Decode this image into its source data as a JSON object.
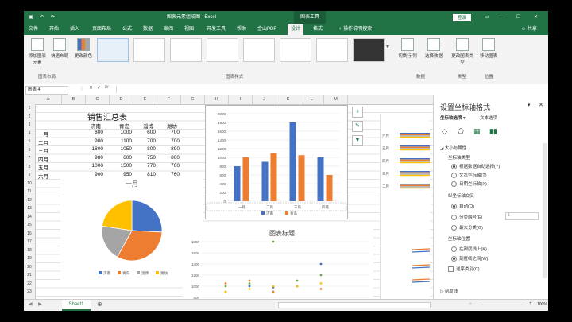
{
  "window": {
    "title": "图表元素组成图 - Excel",
    "context_tab": "图表工具",
    "login": "登录",
    "share": "共享"
  },
  "tabs": [
    "文件",
    "开始",
    "插入",
    "页面布局",
    "公式",
    "数据",
    "审阅",
    "视图",
    "开发工具",
    "帮助",
    "金山PDF",
    "设计",
    "格式",
    "操作说明搜索"
  ],
  "ribbon": {
    "buttons": [
      "添加图表元素",
      "快速布局",
      "更改颜色",
      "切换行/列",
      "选择数据",
      "更改图表类型",
      "移动图表"
    ],
    "groups": [
      "图表布局",
      "图表样式",
      "数据",
      "类型",
      "位置"
    ]
  },
  "namebox": "图表 4",
  "columns": [
    "A",
    "B",
    "C",
    "D",
    "E",
    "F",
    "G",
    "H",
    "I",
    "J",
    "K",
    "L",
    "M"
  ],
  "rows": [
    "1",
    "2",
    "3",
    "4",
    "5",
    "6",
    "7",
    "8",
    "9",
    "10",
    "11",
    "12",
    "13",
    "14",
    "15",
    "16",
    "17",
    "18",
    "19",
    "20",
    "21",
    "22",
    "23"
  ],
  "table": {
    "title": "销售汇总表",
    "headers": [
      "济南",
      "青岛",
      "淄博",
      "潍坊"
    ],
    "rows": [
      {
        "month": "一月",
        "values": [
          "800",
          "1000",
          "600",
          "700"
        ]
      },
      {
        "month": "二月",
        "values": [
          "900",
          "1100",
          "700",
          "700"
        ]
      },
      {
        "month": "三月",
        "values": [
          "1800",
          "1050",
          "800",
          "890"
        ]
      },
      {
        "month": "四月",
        "values": [
          "980",
          "600",
          "750",
          "800"
        ]
      },
      {
        "month": "五月",
        "values": [
          "1000",
          "1500",
          "770",
          "700"
        ]
      },
      {
        "month": "六月",
        "values": [
          "900",
          "950",
          "810",
          "760"
        ]
      }
    ]
  },
  "chart_data": [
    {
      "type": "bar",
      "title": "",
      "categories": [
        "一月",
        "二月",
        "三月",
        "四月"
      ],
      "series": [
        {
          "name": "济南",
          "values": [
            800,
            900,
            1800,
            1000
          ],
          "color": "#4472c4"
        },
        {
          "name": "青岛",
          "values": [
            1000,
            1100,
            1050,
            600
          ],
          "color": "#ed7d31"
        }
      ],
      "ylim": [
        0,
        2000
      ],
      "yticks": [
        "0",
        "200",
        "400",
        "600",
        "800",
        "1000",
        "1200",
        "1400",
        "1600",
        "1800",
        "2000"
      ],
      "legend": "bottom"
    },
    {
      "type": "pie",
      "title": "一月",
      "categories": [
        "济南",
        "青岛",
        "淄博",
        "潍坊"
      ],
      "values": [
        800,
        1000,
        600,
        700
      ],
      "colors": [
        "#4472c4",
        "#ed7d31",
        "#a5a5a5",
        "#ffc000"
      ],
      "legend": "bottom"
    },
    {
      "type": "scatter",
      "title": "图表标题",
      "yticks": [
        "800",
        "1000",
        "1200",
        "1400",
        "1600",
        "1800"
      ],
      "ylim": [
        800,
        1800
      ],
      "series": [
        {
          "name": "济南",
          "color": "#4472c4",
          "values": [
            900,
            1000,
            980,
            1000,
            1400
          ]
        },
        {
          "name": "青岛",
          "color": "#ed7d31",
          "values": [
            1050,
            1100,
            900,
            1000,
            950
          ]
        },
        {
          "name": "淄博",
          "color": "#70ad47",
          "values": [
            1000,
            1050,
            1800,
            1100,
            1200
          ]
        },
        {
          "name": "潍坊",
          "color": "#ffc000",
          "values": [
            900,
            950,
            1000,
            1000,
            1050
          ]
        }
      ]
    }
  ],
  "right_chart_labels": [
    "六月",
    "五月",
    "四月",
    "三月",
    "二月"
  ],
  "pane": {
    "title": "设置坐标轴格式",
    "tab_options": "坐标轴选项",
    "tab_text": "文本选项",
    "section": "大小与属性",
    "axis_type_label": "坐标轴类型",
    "axis_type_options": [
      "根据数据自动选择(Y)",
      "文本坐标轴(T)",
      "日期坐标轴(X)"
    ],
    "cross_label": "纵坐标轴交叉",
    "cross_options": [
      "自动(O)",
      "分类编号(E)",
      "最大分类(G)"
    ],
    "cross_value": "1",
    "position_label": "坐标轴位置",
    "position_options": [
      "在刻度线上(K)",
      "刻度线之间(W)"
    ],
    "reverse": "逆序类别(C)",
    "tick_label": "刻度线"
  },
  "sheet": "Sheet1",
  "zoom": "100%"
}
